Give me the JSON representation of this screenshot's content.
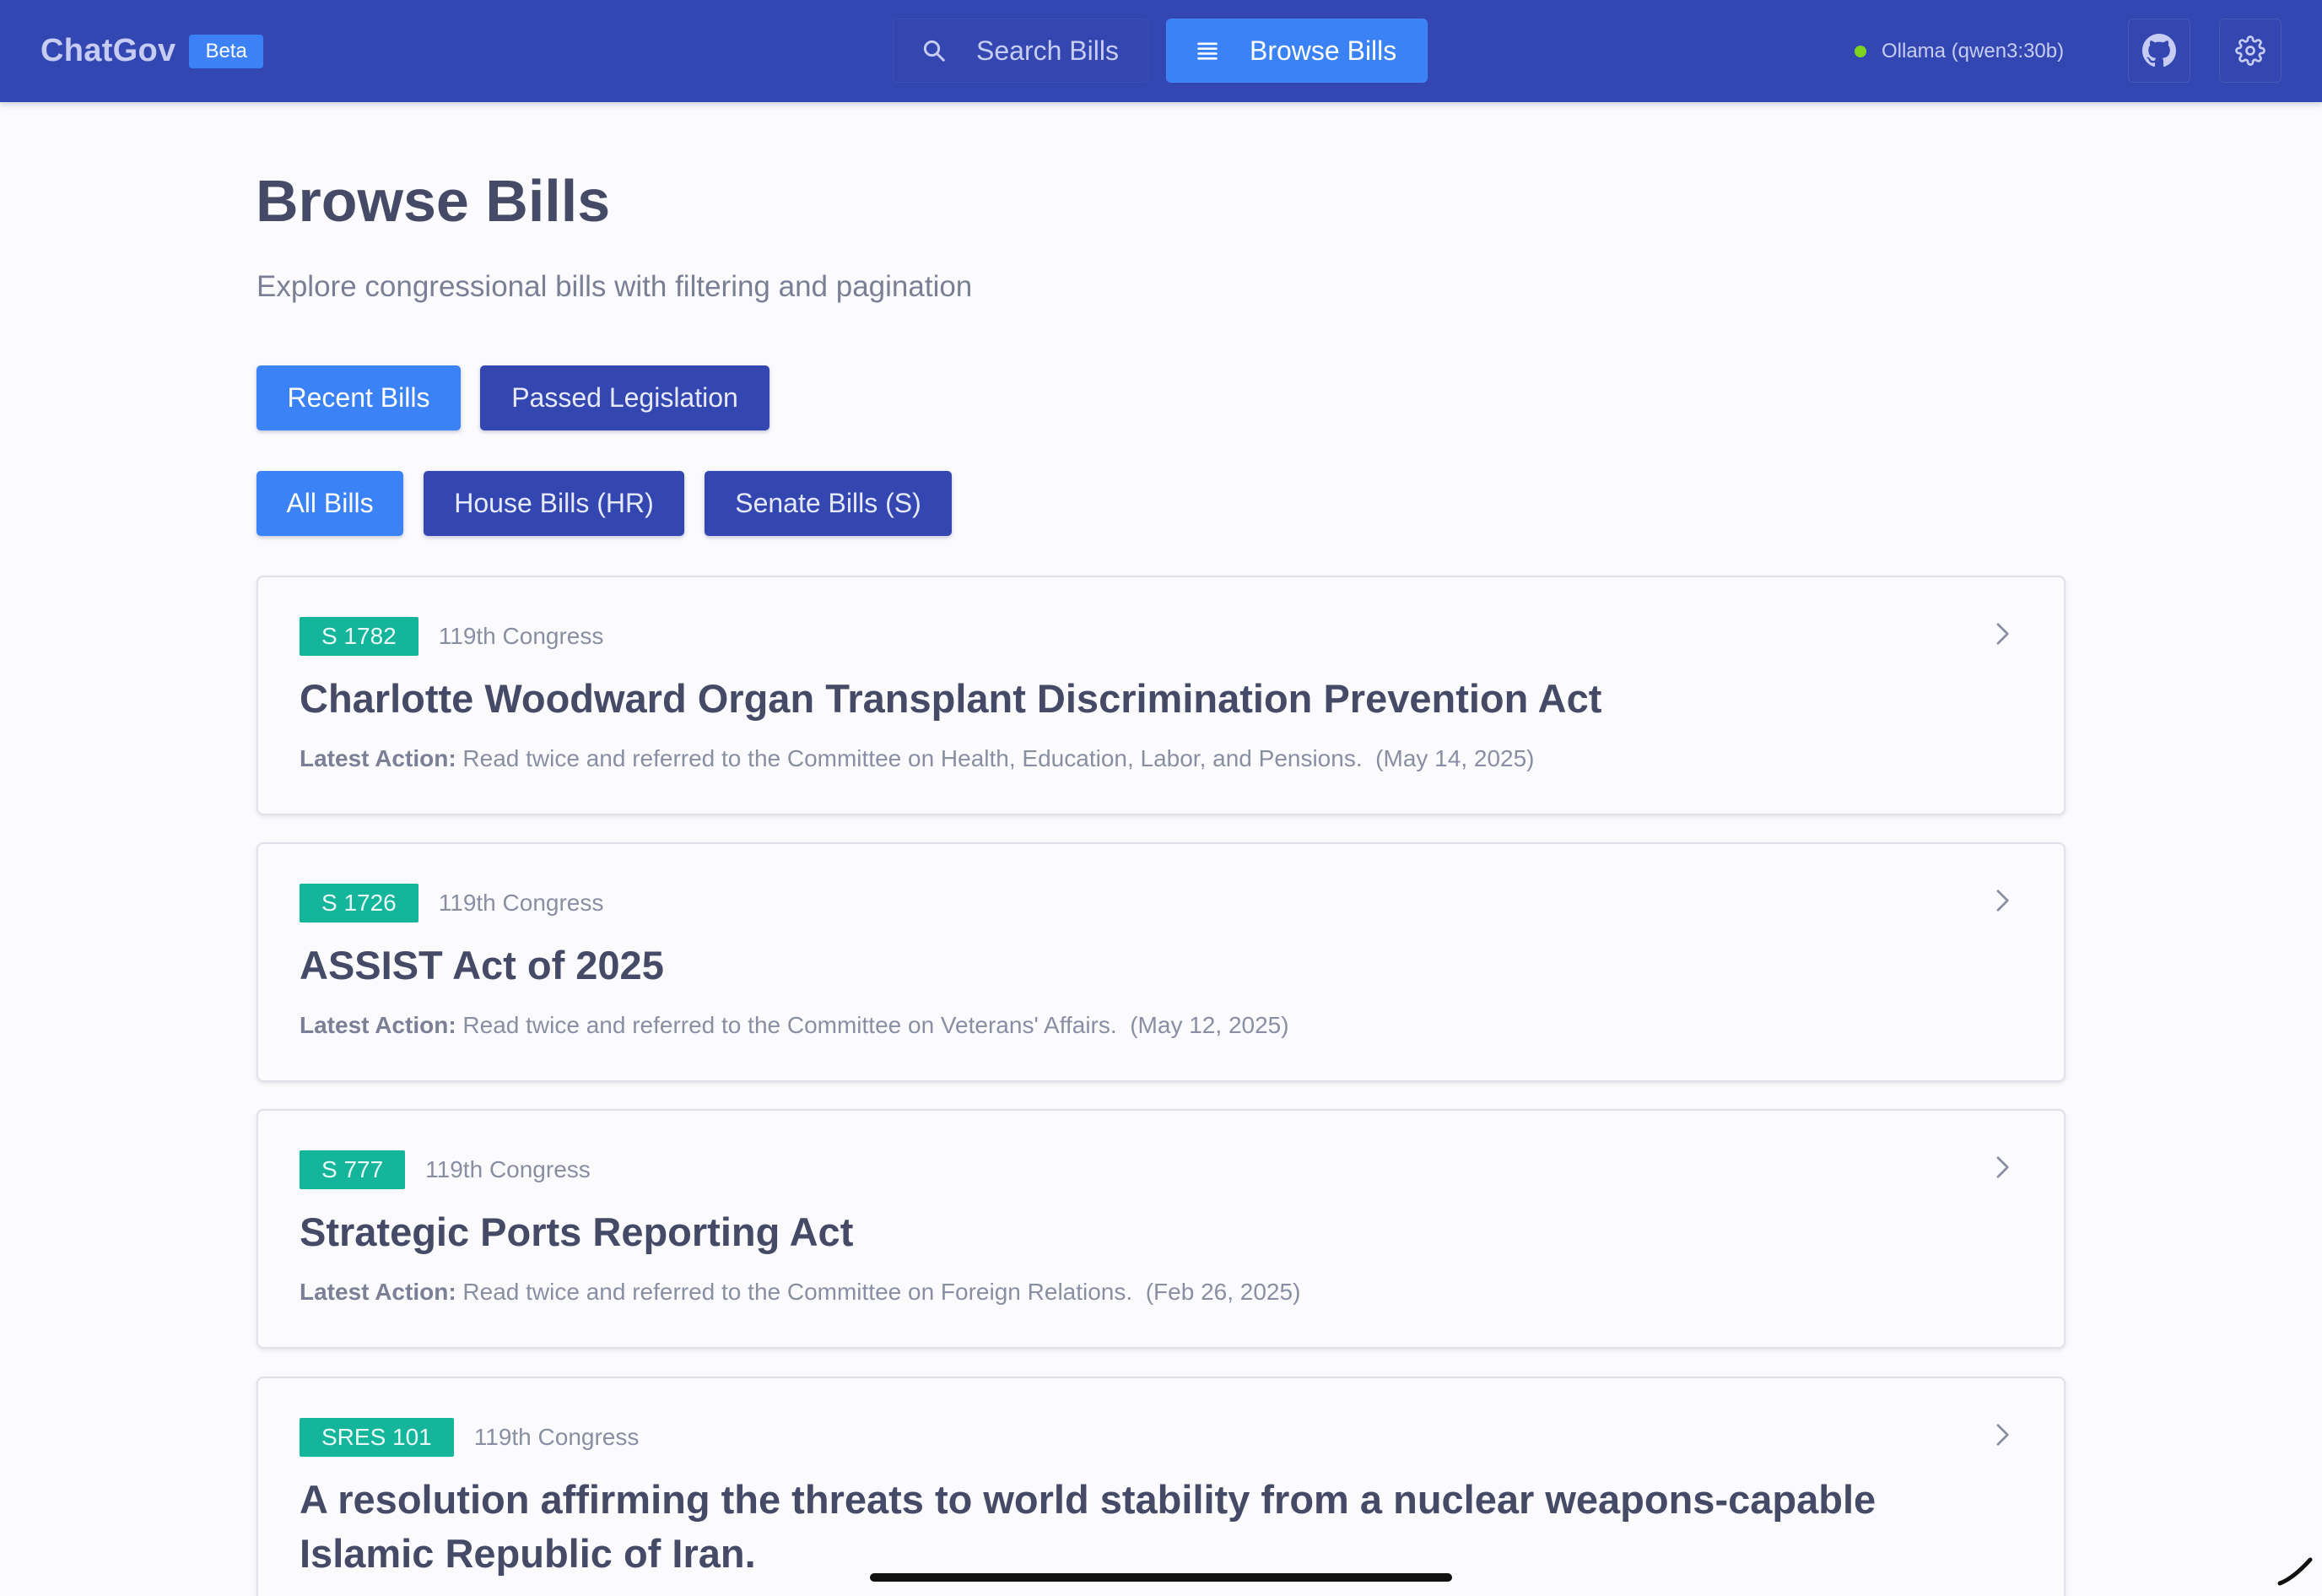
{
  "app": {
    "name": "ChatGov",
    "badge": "Beta"
  },
  "nav": {
    "search_label": "Search Bills",
    "browse_label": "Browse Bills",
    "active": "browse"
  },
  "status": {
    "model_label": "Ollama (qwen3:30b)",
    "indicator_color": "#7ed321"
  },
  "header_icons": [
    "github-icon",
    "gear-icon"
  ],
  "page": {
    "title": "Browse Bills",
    "subtitle": "Explore congressional bills with filtering and pagination"
  },
  "filters": {
    "category": {
      "options": [
        "Recent Bills",
        "Passed Legislation"
      ],
      "selected": "Recent Bills"
    },
    "chamber": {
      "options": [
        "All Bills",
        "House Bills (HR)",
        "Senate Bills (S)"
      ],
      "selected": "All Bills"
    }
  },
  "bills": [
    {
      "id": "S 1782",
      "congress": "119th Congress",
      "title": "Charlotte Woodward Organ Transplant Discrimination Prevention Act",
      "action_label": "Latest Action:",
      "action": "Read twice and referred to the Committee on Health, Education, Labor, and Pensions.",
      "date": "(May 14, 2025)"
    },
    {
      "id": "S 1726",
      "congress": "119th Congress",
      "title": "ASSIST Act of 2025",
      "action_label": "Latest Action:",
      "action": "Read twice and referred to the Committee on Veterans' Affairs.",
      "date": "(May 12, 2025)"
    },
    {
      "id": "S 777",
      "congress": "119th Congress",
      "title": "Strategic Ports Reporting Act",
      "action_label": "Latest Action:",
      "action": "Read twice and referred to the Committee on Foreign Relations.",
      "date": "(Feb 26, 2025)"
    },
    {
      "id": "SRES 101",
      "congress": "119th Congress",
      "title": "A resolution affirming the threats to world stability from a nuclear weapons-capable Islamic Republic of Iran."
    }
  ],
  "colors": {
    "header_bg": "#3347b3",
    "accent_blue": "#3b82f6",
    "bill_badge": "#14b59a",
    "page_bg": "#fbfbfe"
  }
}
